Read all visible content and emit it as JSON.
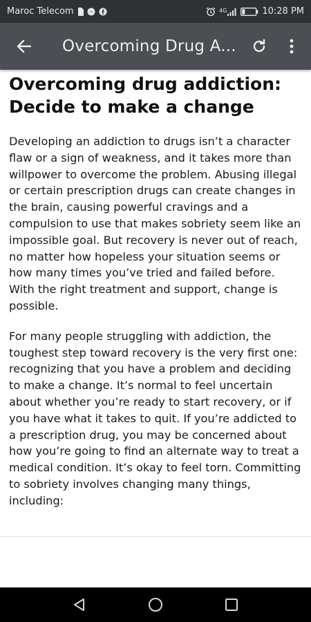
{
  "status_bar": {
    "carrier": "Maroc Telecom",
    "network_label": "4G",
    "time": "10:28 PM"
  },
  "app_bar": {
    "title": "Overcoming Drug A..."
  },
  "article": {
    "title": "Overcoming drug addiction: Decide to make a change",
    "paragraphs": [
      "Developing an addiction to drugs isn’t a character flaw or a sign of weakness, and it takes more than willpower to overcome the problem. Abusing illegal or certain prescription drugs can create changes in the brain, causing powerful cravings and a compulsion to use that makes sobriety seem like an impossible goal. But recovery is never out of reach, no matter how hopeless your situation seems or how many times you’ve tried and failed before. With the right treatment and support, change is possible.",
      "For many people struggling with addiction, the toughest step toward recovery is the very first one: recognizing that you have a problem and deciding to make a change. It’s normal to feel uncertain about whether you’re ready to start recovery, or if you have what it takes to quit. If you’re addicted to a prescription drug, you may be concerned about how you’re going to find an alternate way to treat a medical condition. It’s okay to feel torn. Committing to sobriety involves changing many things, including:"
    ]
  },
  "icons": {
    "status_left": [
      "sim-icon",
      "messenger-icon",
      "facebook-icon"
    ],
    "status_right": [
      "alarm-icon",
      "signal-icon",
      "battery-icon"
    ],
    "app_bar": [
      "back-arrow-icon",
      "refresh-icon",
      "more-vert-icon"
    ],
    "nav": [
      "nav-back-icon",
      "nav-home-icon",
      "nav-recents-icon"
    ]
  },
  "colors": {
    "status_bar": "#2f3235",
    "app_bar": "#4b4e52",
    "nav_bar": "#000000"
  }
}
